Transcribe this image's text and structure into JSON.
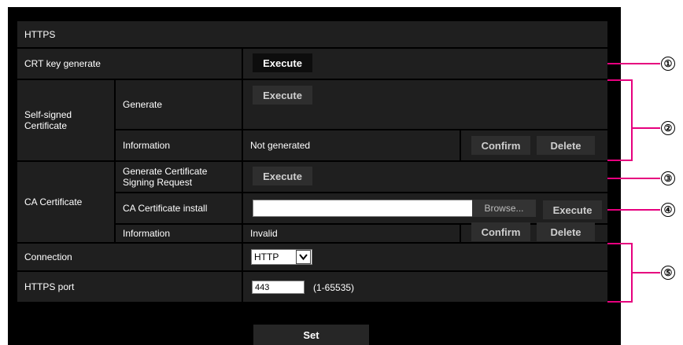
{
  "section_title": "HTTPS",
  "crt_key_generate": {
    "label": "CRT key generate",
    "execute": "Execute"
  },
  "self_signed": {
    "label": "Self-signed Certificate",
    "generate_label": "Generate",
    "generate_execute": "Execute",
    "information_label": "Information",
    "information_value": "Not generated",
    "confirm": "Confirm",
    "delete": "Delete"
  },
  "ca_certificate": {
    "label": "CA Certificate",
    "csr_label": "Generate Certificate Signing Request",
    "csr_execute": "Execute",
    "install_label": "CA Certificate install",
    "install_value": "",
    "browse": "Browse...",
    "install_execute": "Execute",
    "information_label": "Information",
    "information_value": "Invalid",
    "confirm": "Confirm",
    "delete": "Delete"
  },
  "connection": {
    "label": "Connection",
    "selected": "HTTP",
    "dropdown_icon": "chevron-down-icon"
  },
  "https_port": {
    "label": "HTTPS port",
    "value": "443",
    "range": "(1-65535)"
  },
  "set_button": "Set",
  "callouts": [
    "①",
    "②",
    "③",
    "④",
    "⑤"
  ],
  "colors": {
    "callout_line": "#e6007e",
    "panel_bg": "#000000",
    "cell_bg": "#1f1f1f"
  }
}
